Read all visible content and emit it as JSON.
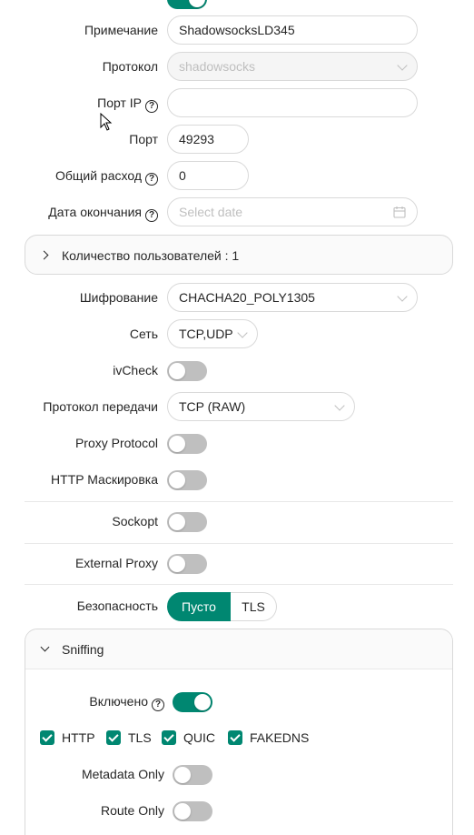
{
  "form": {
    "remark_label": "Примечание",
    "remark_value": "ShadowsocksLD345",
    "protocol_label": "Протокол",
    "protocol_value": "shadowsocks",
    "port_ip_label": "Порт IP",
    "port_ip_value": "",
    "port_label": "Порт",
    "port_value": "49293",
    "total_label": "Общий расход",
    "total_value": "0",
    "expiry_label": "Дата окончания",
    "expiry_placeholder": "Select date",
    "users_panel": "Количество пользователей : 1",
    "cipher_label": "Шифрование",
    "cipher_value": "CHACHA20_POLY1305",
    "network_label": "Сеть",
    "network_value": "TCP,UDP",
    "ivcheck_label": "ivCheck",
    "ivcheck_on": false,
    "transport_label": "Протокол передачи",
    "transport_value": "TCP (RAW)",
    "proxy_protocol_label": "Proxy Protocol",
    "proxy_protocol_on": false,
    "http_mask_label": "HTTP Маскировка",
    "http_mask_on": false,
    "sockopt_label": "Sockopt",
    "sockopt_on": false,
    "external_proxy_label": "External Proxy",
    "external_proxy_on": false,
    "security_label": "Безопасность",
    "security_options": [
      "Пусто",
      "TLS"
    ],
    "security_selected": "Пусто"
  },
  "sniffing": {
    "title": "Sniffing",
    "enabled_label": "Включено",
    "enabled_on": true,
    "protocols": [
      "HTTP",
      "TLS",
      "QUIC",
      "FAKEDNS"
    ],
    "metadata_only_label": "Metadata Only",
    "metadata_only_on": false,
    "route_only_label": "Route Only",
    "route_only_on": false
  },
  "colors": {
    "accent": "#008771",
    "toggle_off": "#bfbfbf",
    "border": "#d9d9d9"
  },
  "icons": [
    "help-icon",
    "calendar-icon",
    "chevron-down-icon",
    "chevron-right-icon",
    "check-icon",
    "mouse-cursor-icon"
  ]
}
